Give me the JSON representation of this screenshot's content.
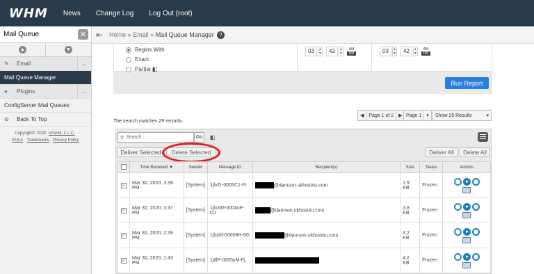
{
  "topbar": {
    "logo": "WHM",
    "nav": [
      "News",
      "Change Log",
      "Log Out (root)"
    ]
  },
  "sidebar": {
    "search_value": "Mail Queue",
    "clear_glyph": "✕",
    "items": [
      {
        "label": "Email",
        "type": "group"
      },
      {
        "label": "Mail Queue Manager",
        "type": "active"
      },
      {
        "label": "Plugins",
        "type": "group"
      },
      {
        "label": "ConfigServer Mail Queues",
        "type": "item"
      },
      {
        "label": "Back To Top",
        "type": "item"
      }
    ],
    "footer": {
      "copyright": "Copyright© 2020",
      "company": "cPanel, L.L.C.",
      "eula": "EULA",
      "trademarks": "Trademarks",
      "privacy": "Privacy Policy"
    }
  },
  "breadcrumb": {
    "home": "Home",
    "sep": "»",
    "section": "Email",
    "current": "Mail Queue Manager"
  },
  "search_options": {
    "match_modes": [
      "Begins With",
      "Exact",
      "Partial"
    ],
    "selected": "Begins With",
    "time_from": {
      "hour": "03",
      "minute": "42",
      "am": "AM",
      "pm": "PM"
    },
    "time_to": {
      "hour": "03",
      "minute": "42",
      "am": "AM",
      "pm": "PM"
    },
    "run_button": "Run Report"
  },
  "results": {
    "matches_text": "The search matches 29 records.",
    "pager": {
      "page_of": "Page 1 of 2",
      "page_select": "Page 1",
      "show_select": "Show 25 Results"
    },
    "search_placeholder": "Search ...",
    "go_label": "Go",
    "deliver_selected": "Deliver Selected",
    "delete_selected": "Delete Selected",
    "deliver_all": "Deliver All",
    "delete_all": "Delete All",
    "columns": [
      "Time Received",
      "Sender",
      "Message ID",
      "Recipient(s)",
      "Size",
      "Status",
      "Actions"
    ],
    "rows": [
      {
        "time": "Mar 30, 2020, 3:39 PM",
        "sender": "[System]",
        "msgid": "1jlvZr-0005C1-Fr",
        "recipient": "@damson.ukhost4u.com",
        "size": "1.9 KB",
        "status": "Frozen"
      },
      {
        "time": "Mar 30, 2020, 3:37 PM",
        "sender": "[System]",
        "msgid": "1jlvXM-0004uF-DJ",
        "recipient": "@damson.ukhost4u.com",
        "size": "3.8 KB",
        "status": "Frozen"
      },
      {
        "time": "Mar 30, 2020, 2:39 PM",
        "sender": "[System]",
        "msgid": "1jlud3-00058H-9G",
        "recipient": "@damson.ukhost4u.com",
        "size": "3.2 KB",
        "status": "Frozen"
      },
      {
        "time": "Mar 30, 2020, 1:43 PM",
        "sender": "[System]",
        "msgid": "1jltlP-0005yM-Fj",
        "recipient": "",
        "size": "4.2 KB",
        "status": "Frozen"
      }
    ]
  },
  "colors": {
    "topbar": "#293a4a",
    "accent": "#2a7de1",
    "highlight_ring": "#e31b23"
  }
}
